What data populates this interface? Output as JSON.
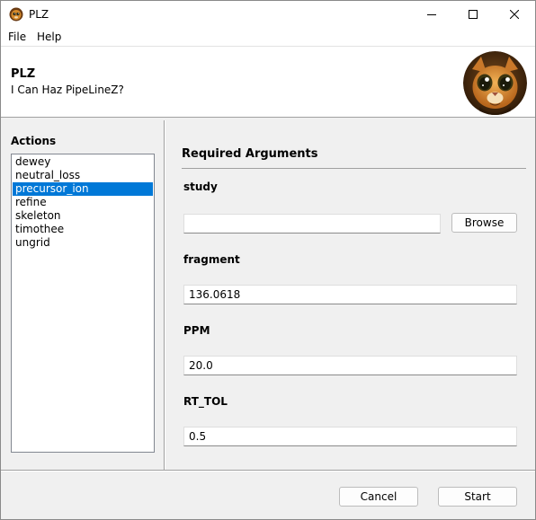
{
  "window": {
    "title": "PLZ",
    "controls": [
      "minimize-icon",
      "maximize-icon",
      "close-icon"
    ]
  },
  "menu": {
    "file": "File",
    "help": "Help"
  },
  "header": {
    "title": "PLZ",
    "subtitle": "I Can Haz PipeLineZ?",
    "avatar_icon": "cat-avatar-icon"
  },
  "actions": {
    "label": "Actions",
    "items": [
      "dewey",
      "neutral_loss",
      "precursor_ion",
      "refine",
      "skeleton",
      "timothee",
      "ungrid"
    ],
    "selected": "precursor_ion"
  },
  "required": {
    "title": "Required Arguments",
    "study": {
      "label": "study",
      "value": ""
    },
    "browse_label": "Browse",
    "fragment": {
      "label": "fragment",
      "value": "136.0618"
    },
    "ppm": {
      "label": "PPM",
      "value": "20.0"
    },
    "rt_tol": {
      "label": "RT_TOL",
      "value": "0.5"
    }
  },
  "footer": {
    "cancel_label": "Cancel",
    "start_label": "Start"
  },
  "colors": {
    "selection": "#0078d7",
    "window_bg": "#f0f0f0"
  }
}
